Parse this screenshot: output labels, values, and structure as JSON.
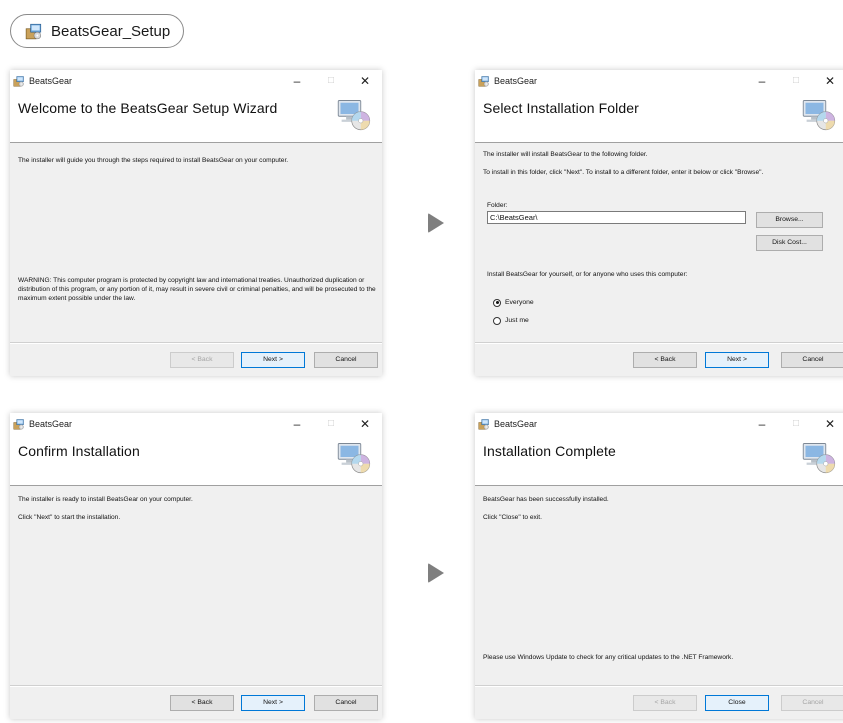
{
  "file_chip": {
    "label": "BeatsGear_Setup",
    "icon": "installer-icon"
  },
  "colors": {
    "accent": "#0078d7",
    "window_bg": "#f0f0f0",
    "arrow": "#7f7f7f"
  },
  "window_title": "BeatsGear",
  "controls": {
    "minimize": "–",
    "maximize": "□",
    "close": "✕"
  },
  "step1": {
    "heading": "Welcome to the BeatsGear Setup Wizard",
    "text": "The installer will guide you through the steps required to install BeatsGear on your computer.",
    "warning": "WARNING: This computer program is protected by copyright law and international treaties. Unauthorized duplication or distribution of this program, or any portion of it, may result in severe civil or criminal penalties, and will be prosecuted to the maximum extent possible under the law.",
    "back": "< Back",
    "next": "Next >",
    "cancel": "Cancel"
  },
  "step2": {
    "heading": "Select Installation Folder",
    "line1": "The installer will install BeatsGear to the following folder.",
    "line2": "To install in this folder, click \"Next\". To install to a different folder, enter it below or click \"Browse\".",
    "folder_label": "Folder:",
    "folder_value": "C:\\BeatsGear\\",
    "browse": "Browse...",
    "disk_cost": "Disk Cost...",
    "install_for": "Install BeatsGear for yourself, or for anyone who uses this computer:",
    "option_everyone": "Everyone",
    "option_just_me": "Just me",
    "selected_option": "Everyone",
    "back": "< Back",
    "next": "Next >",
    "cancel": "Cancel"
  },
  "step3": {
    "heading": "Confirm Installation",
    "line1": "The installer is ready to install BeatsGear on your computer.",
    "line2": "Click \"Next\" to start the installation.",
    "back": "< Back",
    "next": "Next >",
    "cancel": "Cancel"
  },
  "step4": {
    "heading": "Installation Complete",
    "line1": "BeatsGear has been successfully installed.",
    "line2": "Click \"Close\" to exit.",
    "note": "Please use Windows Update to check for any critical updates to the .NET Framework.",
    "back": "< Back",
    "close": "Close",
    "cancel": "Cancel"
  }
}
